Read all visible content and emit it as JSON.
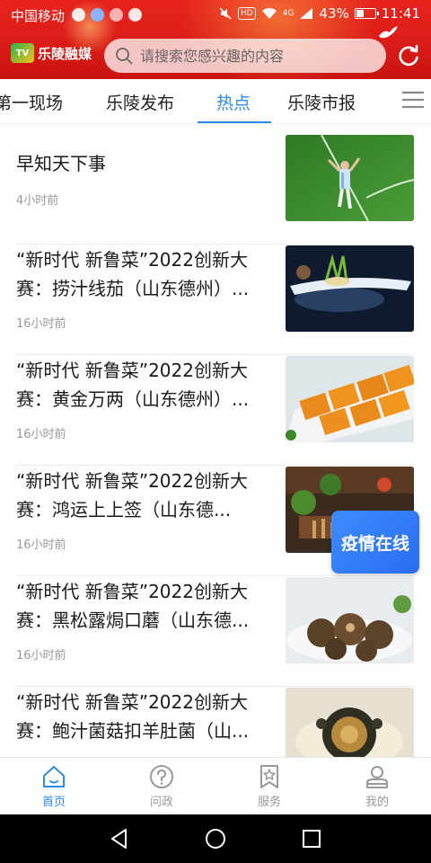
{
  "status_bar": {
    "carrier": "中国移动",
    "hd": "HD",
    "network": "4G",
    "battery": "43%",
    "battery_level": 0.43,
    "time": "11:41"
  },
  "header": {
    "logo_mark": "TV",
    "logo_text": "乐陵融媒",
    "search_placeholder": "请搜索您感兴趣的内容"
  },
  "tabs": [
    {
      "label": "第一现场",
      "active": false
    },
    {
      "label": "乐陵发布",
      "active": false
    },
    {
      "label": "热点",
      "active": true
    },
    {
      "label": "乐陵市报",
      "active": false
    }
  ],
  "news": [
    {
      "title": "早知天下事",
      "time": "4小时前"
    },
    {
      "title": "“新时代 新鲁菜”2022创新大赛：捞汁线茄（山东德州）...",
      "time": "16小时前"
    },
    {
      "title": "“新时代 新鲁菜”2022创新大赛：黄金万两（山东德州）...",
      "time": "16小时前"
    },
    {
      "title": "“新时代 新鲁菜”2022创新大赛：鸿运上上签（山东德...",
      "time": "16小时前"
    },
    {
      "title": "“新时代 新鲁菜”2022创新大赛：黑松露焗口蘑（山东德...",
      "time": "16小时前"
    },
    {
      "title": "“新时代 新鲁菜”2022创新大赛：鲍汁菌菇扣羊肚菌（山...",
      "time": ""
    }
  ],
  "float_badge": "疫情在线",
  "bottom_nav": [
    {
      "label": "首页",
      "icon": "home-icon",
      "active": true
    },
    {
      "label": "问政",
      "icon": "question-icon",
      "active": false
    },
    {
      "label": "服务",
      "icon": "service-icon",
      "active": false
    },
    {
      "label": "我的",
      "icon": "profile-icon",
      "active": false
    }
  ],
  "colors": {
    "brand_red": "#d81b17",
    "accent_blue": "#2b8be8",
    "muted_text": "#999999"
  }
}
